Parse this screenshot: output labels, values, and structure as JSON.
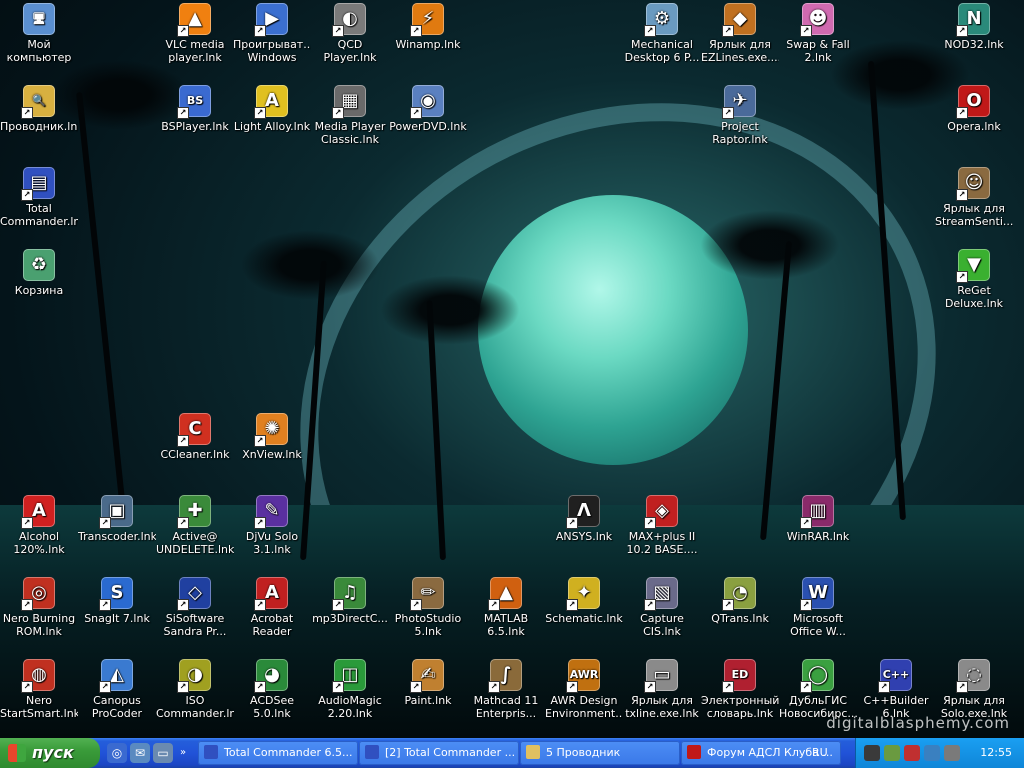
{
  "desktop": {
    "watermark": "digitalblasphemy.com",
    "icons": [
      {
        "label": "Мой компьютер",
        "glyph": "🖥",
        "color": "#5a8fd0",
        "shortcut": false
      },
      {
        "label": "VLC media player.lnk",
        "glyph": "▲",
        "color": "#f08010",
        "shortcut": true
      },
      {
        "label": "Проигрыват... Windows Me...",
        "glyph": "▶",
        "color": "#3b6fd0",
        "shortcut": true
      },
      {
        "label": "QCD Player.lnk",
        "glyph": "◐",
        "color": "#7a7a7a",
        "shortcut": true
      },
      {
        "label": "Winamp.lnk",
        "glyph": "⚡",
        "color": "#e07a10",
        "shortcut": true
      },
      {
        "label": "Mechanical Desktop 6 P...",
        "glyph": "⚙",
        "color": "#6a9ac0",
        "shortcut": true
      },
      {
        "label": "Ярлык для EZLines.exe....",
        "glyph": "◆",
        "color": "#c07020",
        "shortcut": true
      },
      {
        "label": "Swap & Fall 2.lnk",
        "glyph": "☻",
        "color": "#d06ab0",
        "shortcut": true
      },
      {
        "label": "NOD32.lnk",
        "glyph": "N",
        "color": "#2a8a7a",
        "shortcut": true
      },
      {
        "label": "Проводник.lnk",
        "glyph": "🔍",
        "color": "#d8b040",
        "shortcut": true
      },
      {
        "label": "BSPlayer.lnk",
        "glyph": "BS",
        "color": "#3a6ad0",
        "shortcut": true
      },
      {
        "label": "Light Alloy.lnk",
        "glyph": "A",
        "color": "#e0c020",
        "shortcut": true
      },
      {
        "label": "Media Player Classic.lnk",
        "glyph": "▦",
        "color": "#6a6a6a",
        "shortcut": true
      },
      {
        "label": "PowerDVD.lnk",
        "glyph": "◉",
        "color": "#5a80c0",
        "shortcut": true
      },
      {
        "label": "Project Raptor.lnk",
        "glyph": "✈",
        "color": "#4a6a9a",
        "shortcut": true
      },
      {
        "label": "Opera.lnk",
        "glyph": "O",
        "color": "#c01818",
        "shortcut": true
      },
      {
        "label": "Total Commander.lnk",
        "glyph": "▤",
        "color": "#3050c0",
        "shortcut": true
      },
      {
        "label": "Ярлык для StreamSenti...",
        "glyph": "☺",
        "color": "#8a6a40",
        "shortcut": true
      },
      {
        "label": "Корзина",
        "glyph": "♻",
        "color": "#4aa070",
        "shortcut": false
      },
      {
        "label": "ReGet Deluxe.lnk",
        "glyph": "▼",
        "color": "#3ab030",
        "shortcut": true
      },
      {
        "label": "CCleaner.lnk",
        "glyph": "C",
        "color": "#d03020",
        "shortcut": true
      },
      {
        "label": "XnView.lnk",
        "glyph": "✺",
        "color": "#e08020",
        "shortcut": true
      },
      {
        "label": "Alcohol 120%.lnk",
        "glyph": "A",
        "color": "#d02020",
        "shortcut": true
      },
      {
        "label": "Transcoder.lnk",
        "glyph": "▣",
        "color": "#4a6a8a",
        "shortcut": true
      },
      {
        "label": "Active@ UNDELETE.lnk",
        "glyph": "✚",
        "color": "#3a8a3a",
        "shortcut": true
      },
      {
        "label": "DjVu Solo 3.1.lnk",
        "glyph": "✎",
        "color": "#5a30a0",
        "shortcut": true
      },
      {
        "label": "ANSYS.lnk",
        "glyph": "Λ",
        "color": "#202020",
        "shortcut": true
      },
      {
        "label": "MAX+plus II 10.2 BASE....",
        "glyph": "◈",
        "color": "#c02020",
        "shortcut": true
      },
      {
        "label": "WinRAR.lnk",
        "glyph": "▥",
        "color": "#8a2a6a",
        "shortcut": true
      },
      {
        "label": "Nero Burning ROM.lnk",
        "glyph": "◎",
        "color": "#c03020",
        "shortcut": true
      },
      {
        "label": "SnagIt 7.lnk",
        "glyph": "S",
        "color": "#2a6ad0",
        "shortcut": true
      },
      {
        "label": "SiSoftware Sandra Pr...",
        "glyph": "◇",
        "color": "#2040a0",
        "shortcut": true
      },
      {
        "label": "Acrobat Reader 5.0.lnk",
        "glyph": "A",
        "color": "#c02020",
        "shortcut": true
      },
      {
        "label": "mp3DirectC...",
        "glyph": "♫",
        "color": "#3a8a3a",
        "shortcut": true
      },
      {
        "label": "PhotoStudio 5.lnk",
        "glyph": "✏",
        "color": "#8a6a40",
        "shortcut": true
      },
      {
        "label": "MATLAB 6.5.lnk",
        "glyph": "▲",
        "color": "#d06010",
        "shortcut": true
      },
      {
        "label": "Schematic.lnk",
        "glyph": "✦",
        "color": "#d0b020",
        "shortcut": true
      },
      {
        "label": "Capture CIS.lnk",
        "glyph": "▧",
        "color": "#6a6a8a",
        "shortcut": true
      },
      {
        "label": "QTrans.lnk",
        "glyph": "◔",
        "color": "#8aa040",
        "shortcut": true
      },
      {
        "label": "Microsoft Office W...",
        "glyph": "W",
        "color": "#2a50b0",
        "shortcut": true
      },
      {
        "label": "Nero StartSmart.lnk",
        "glyph": "◍",
        "color": "#c03020",
        "shortcut": true
      },
      {
        "label": "Canopus ProCoder 2.lnk",
        "glyph": "◭",
        "color": "#3a7ad0",
        "shortcut": true
      },
      {
        "label": "ISO Commander.lnk",
        "glyph": "◑",
        "color": "#a0a020",
        "shortcut": true
      },
      {
        "label": "ACDSee 5.0.lnk",
        "glyph": "◕",
        "color": "#2a8a3a",
        "shortcut": true
      },
      {
        "label": "AudioMagic 2.20.lnk",
        "glyph": "◫",
        "color": "#2a9a3a",
        "shortcut": true
      },
      {
        "label": "Paint.lnk",
        "glyph": "✍",
        "color": "#c08030",
        "shortcut": true
      },
      {
        "label": "Mathcad 11 Enterpris...",
        "glyph": "∫",
        "color": "#8a6a3a",
        "shortcut": true
      },
      {
        "label": "AWR Design Environment...",
        "glyph": "AWR",
        "color": "#c07010",
        "shortcut": true
      },
      {
        "label": "Ярлык для txline.exe.lnk",
        "glyph": "▭",
        "color": "#8a8a8a",
        "shortcut": true
      },
      {
        "label": "Электронный словарь.lnk",
        "glyph": "ED",
        "color": "#b02030",
        "shortcut": true
      },
      {
        "label": "ДубльГИС Новосибирс...",
        "glyph": "◯",
        "color": "#3aa040",
        "shortcut": true
      },
      {
        "label": "C++Builder 6.lnk",
        "glyph": "C++",
        "color": "#3040b0",
        "shortcut": true
      },
      {
        "label": "Ярлык для Solo.exe.lnk",
        "glyph": "◌",
        "color": "#8a8a8a",
        "shortcut": true
      }
    ]
  },
  "taskbar": {
    "start_label": "пуск",
    "tasks": [
      {
        "label": "Total Commander 6.5...",
        "color": "#3050c0"
      },
      {
        "label": "[2] Total Commander ...",
        "color": "#3050c0"
      },
      {
        "label": "5 Проводник",
        "color": "#e0c060"
      },
      {
        "label": "Форум АДСЛ Клуба ...",
        "color": "#c01818"
      }
    ],
    "language": "RU",
    "clock": "12:55"
  }
}
